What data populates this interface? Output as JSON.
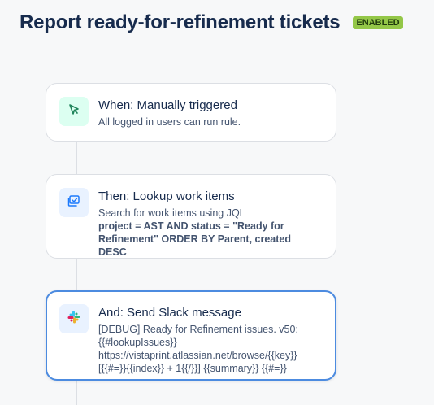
{
  "header": {
    "title": "Report ready-for-refinement tickets",
    "status_badge": "ENABLED"
  },
  "steps": [
    {
      "title": "When: Manually triggered",
      "description": "All logged in users can run rule.",
      "icon": "cursor-trigger-icon"
    },
    {
      "title": "Then: Lookup work items",
      "description": "Search for work items using JQL",
      "jql": "project = AST AND status = \"Ready for Refinement\" ORDER BY Parent, created DESC",
      "icon": "lookup-work-items-icon"
    },
    {
      "title": "And: Send Slack message",
      "message_lines": [
        "[DEBUG] Ready for Refinement issues. v50:",
        "{{#lookupIssues}}",
        "https://vistaprint.atlassian.net/browse/{{key}}",
        "[{{#=}}{{index}} + 1{{/}}] {{summary}} {{#=}}"
      ],
      "icon": "slack-icon"
    }
  ],
  "colors": {
    "badge": "#94c748",
    "selected_border": "#4c8be0",
    "trigger_icon_bg": "#dcfff1",
    "action_icon_bg": "#e9f2ff"
  }
}
